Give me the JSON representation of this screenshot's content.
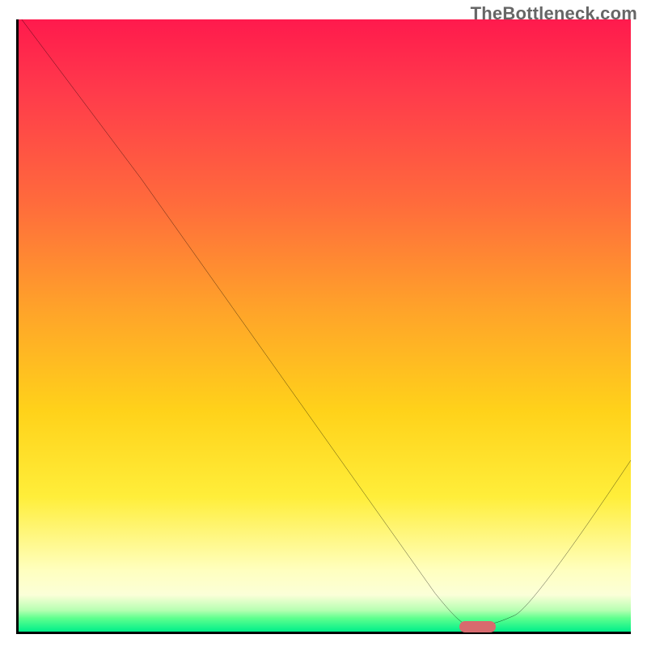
{
  "attribution": "TheBottleneck.com",
  "chart_data": {
    "type": "line",
    "title": "",
    "xlabel": "",
    "ylabel": "",
    "xlim": [
      0,
      100
    ],
    "ylim": [
      0,
      100
    ],
    "grid": false,
    "legend": false,
    "series": [
      {
        "name": "bottleneck-curve",
        "x": [
          0.5,
          20,
          72,
          78,
          84,
          100
        ],
        "y": [
          100,
          74,
          1.3,
          1.3,
          4,
          28
        ]
      }
    ],
    "marker": {
      "name": "optimal-zone",
      "x_start": 72,
      "x_end": 78,
      "y": 0.7
    },
    "background_gradient_stops": [
      {
        "pct": 0,
        "color": "#ff1a4d"
      },
      {
        "pct": 30,
        "color": "#ff6b3c"
      },
      {
        "pct": 64,
        "color": "#ffd21a"
      },
      {
        "pct": 90,
        "color": "#ffffbf"
      },
      {
        "pct": 100,
        "color": "#00ef8a"
      }
    ]
  }
}
